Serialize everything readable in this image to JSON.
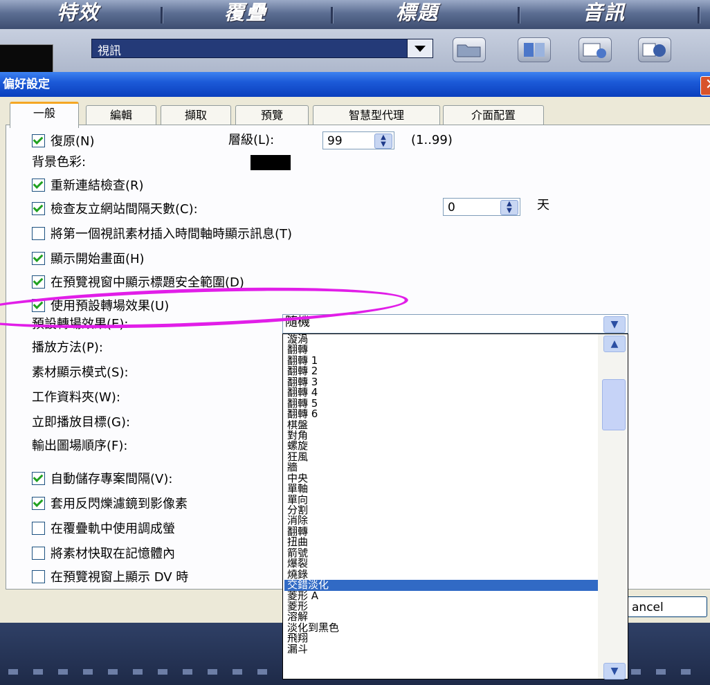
{
  "top_tabs": [
    "特效",
    "覆疊",
    "標題",
    "音訊"
  ],
  "toolbar": {
    "media_type": "視訊",
    "icons": [
      "folder-icon",
      "sort-icon",
      "library-options-icon",
      "capture-icon"
    ]
  },
  "dialog": {
    "title": "偏好設定",
    "close_glyph": "✕",
    "tabs": [
      "一般",
      "編輯",
      "擷取",
      "預覽",
      "智慧型代理",
      "介面配置"
    ],
    "active_tab": "一般",
    "undo": {
      "label": "復原(N)",
      "checked": true
    },
    "undo_levels": {
      "label": "層級(L):",
      "value": "99",
      "range": "(1..99)"
    },
    "background_color": {
      "label": "背景色彩:",
      "color": "#000000"
    },
    "relink_check": {
      "label": "重新連結檢查(R)",
      "checked": true
    },
    "check_website": {
      "label": "檢查友立網站間隔天數(C):",
      "checked": true,
      "value": "0",
      "unit": "天"
    },
    "show_msg_first_video": {
      "label": "將第一個視訊素材插入時間軸時顯示訊息(T)",
      "checked": false
    },
    "show_startup": {
      "label": "顯示開始畫面(H)",
      "checked": true
    },
    "show_title_safe": {
      "label": "在預覽視窗中顯示標題安全範圍(D)",
      "checked": true
    },
    "use_default_transition": {
      "label": "使用預設轉場效果(U)",
      "checked": true
    },
    "default_transition": {
      "label": "預設轉場效果(E):",
      "value": "隨機"
    },
    "playback_method": {
      "label": "播放方法(P):"
    },
    "clip_display_mode": {
      "label": "素材顯示模式(S):"
    },
    "working_folder": {
      "label": "工作資料夾(W):"
    },
    "instant_play_target": {
      "label": "立即播放目標(G):"
    },
    "output_order": {
      "label": "輸出圖場順序(F):"
    },
    "autosave": {
      "label": "自動儲存專案間隔(V):",
      "checked": true
    },
    "anti_flicker": {
      "label": "套用反閃爍濾鏡到影像素",
      "checked": true
    },
    "overlay_track": {
      "label": "在覆疊軌中使用調成螢",
      "checked": false
    },
    "cache_clips": {
      "label": "將素材快取在記憶體內",
      "checked": false
    },
    "show_dv": {
      "label": "在預覽視窗上顯示 DV 時",
      "checked": false
    },
    "cancel_label": "ancel"
  },
  "transition_list": {
    "items": [
      "漩渦",
      "翻轉",
      "翻轉 1",
      "翻轉 2",
      "翻轉 3",
      "翻轉 4",
      "翻轉 5",
      "翻轉 6",
      "棋盤",
      "對角",
      "螺旋",
      "狂風",
      "牆",
      "中央",
      "單軸",
      "單向",
      "分割",
      "消除",
      "翻轉",
      "扭曲",
      "箭號",
      "爆裂",
      "燒錄",
      "交錯淡化",
      "菱形 A",
      "菱形",
      "溶解",
      "淡化到黑色",
      "飛翔",
      "漏斗"
    ],
    "selected": "交錯淡化"
  },
  "highlight_color": "#e11ee8"
}
